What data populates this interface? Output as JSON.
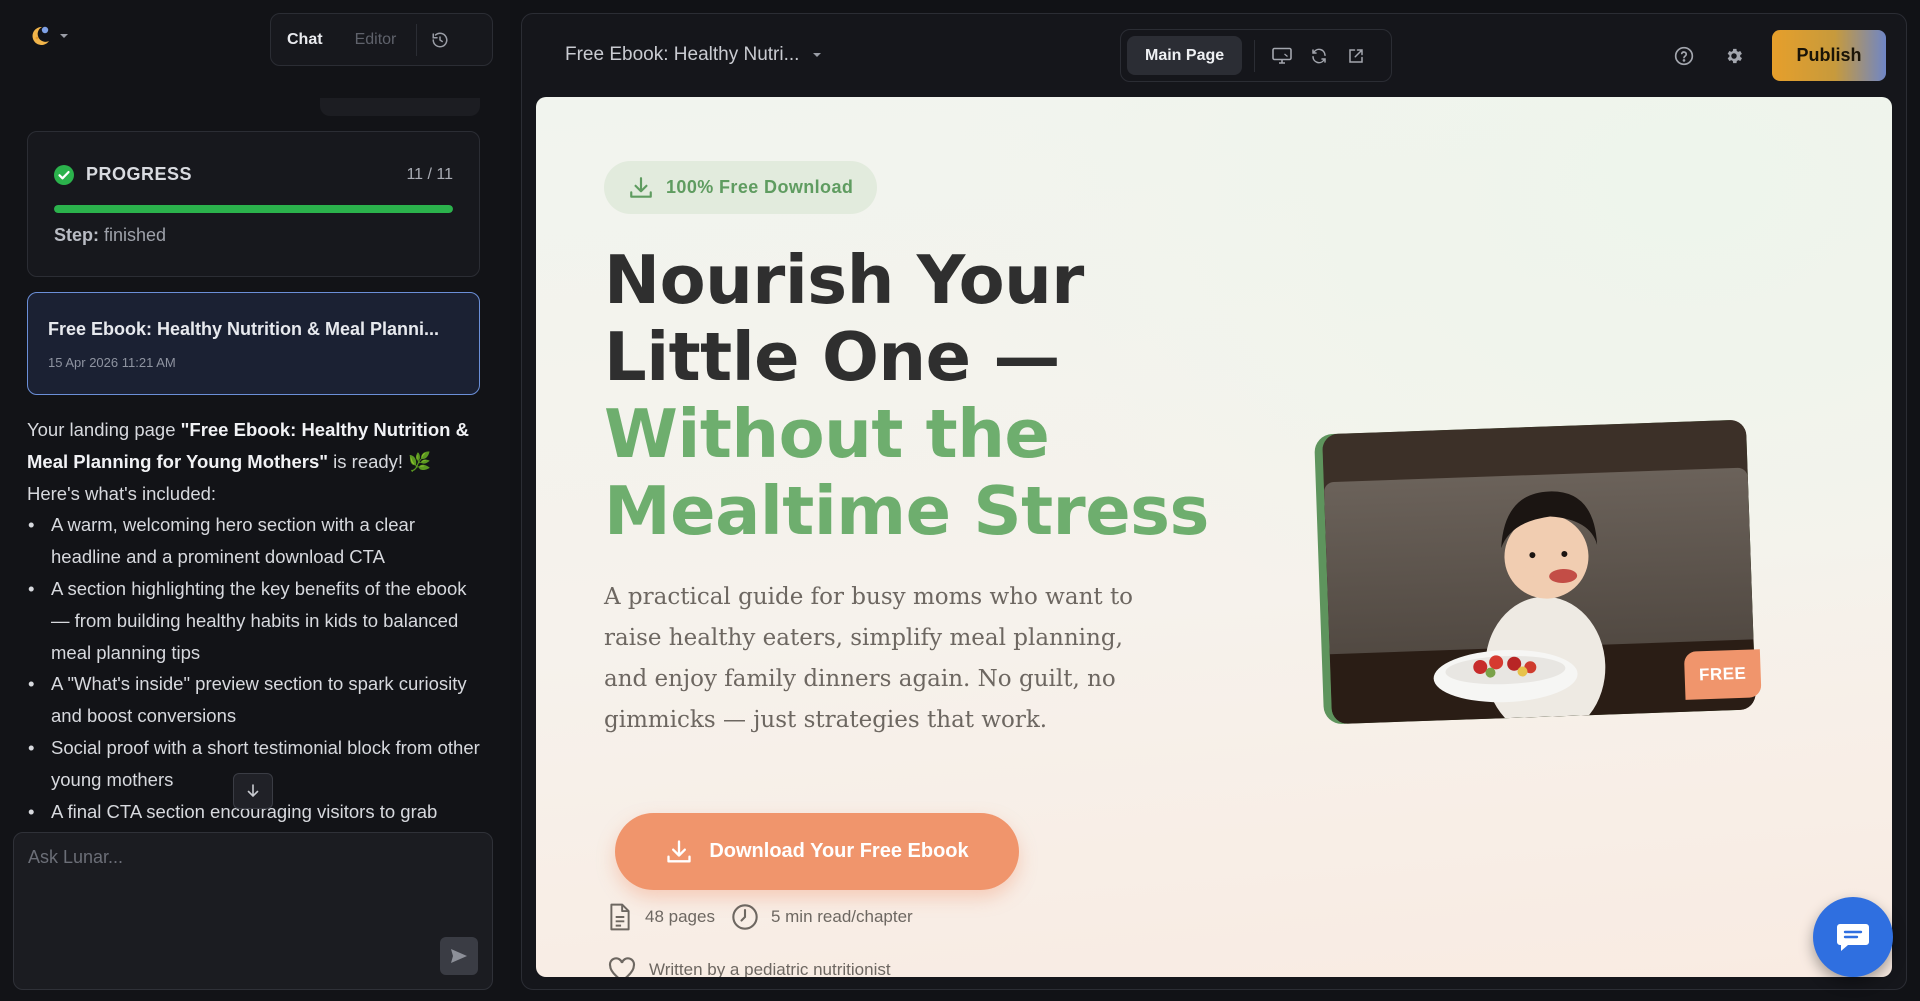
{
  "app": {
    "mode_tabs": {
      "chat": "Chat",
      "editor": "Editor"
    }
  },
  "progress": {
    "title": "PROGRESS",
    "count": "11 / 11",
    "fraction": 1.0,
    "step_label": "Step:",
    "step_value": "finished"
  },
  "page_card": {
    "title": "Free Ebook: Healthy Nutrition & Meal Planni...",
    "date": "15 Apr 2026 11:21 AM"
  },
  "chat": {
    "intro_before": "Your landing page ",
    "intro_bold": "\"Free Ebook: Healthy Nutrition & Meal Planning for Young Mothers\"",
    "intro_after": " is ready! 🌿",
    "included": "Here's what's included:",
    "bullets": [
      "A warm, welcoming hero section with a clear headline and a prominent download CTA",
      "A section highlighting the key benefits of the ebook — from building healthy habits in kids to balanced meal planning tips",
      "A \"What's inside\" preview section to spark curiosity and boost conversions",
      "Social proof with a short testimonial block from other young mothers",
      "A final CTA section encouraging visitors to grab"
    ]
  },
  "ask": {
    "placeholder": "Ask Lunar..."
  },
  "toolbar": {
    "page_selector": "Free Ebook: Healthy Nutri...",
    "main_page": "Main Page",
    "publish": "Publish"
  },
  "preview": {
    "badge": "100% Free Download",
    "headline_line1": "Nourish Your",
    "headline_line2": "Little One —",
    "headline_accent1": "Without the",
    "headline_accent2": "Mealtime Stress",
    "subtext": "A practical guide for busy moms who want to raise healthy eaters, simplify meal planning, and enjoy family dinners again. No guilt, no gimmicks — just strategies that work.",
    "cta": "Download Your Free Ebook",
    "pages": "48 pages",
    "read_time": "5 min read/chapter",
    "author": "Written by a pediatric nutritionist",
    "free_tag": "FREE"
  },
  "colors": {
    "accent_green": "#6eae6e",
    "cta_orange": "#f0956c",
    "progress_green": "#2bb24c",
    "selected_border": "#6b8fd8"
  }
}
